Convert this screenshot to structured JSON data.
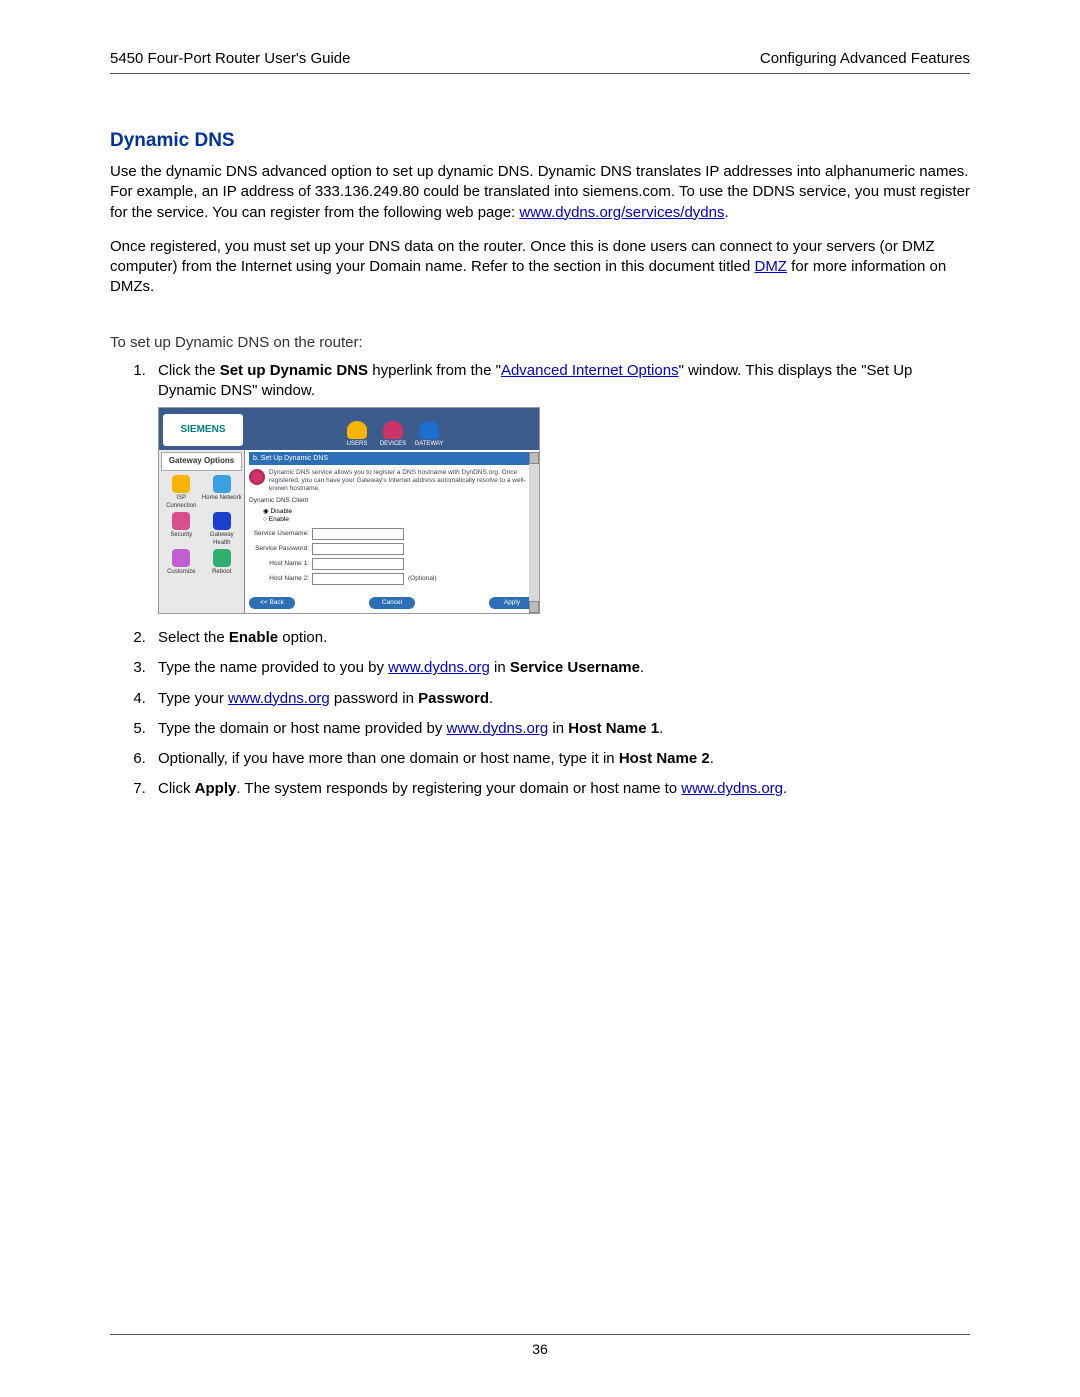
{
  "header": {
    "left": "5450 Four-Port Router User's Guide",
    "right": "Configuring Advanced Features"
  },
  "title": "Dynamic DNS",
  "para1": {
    "t1": "Use the dynamic DNS advanced option to set up dynamic DNS. Dynamic DNS translates IP addresses into alphanumeric names. For example, an IP address of 333.136.249.80 could be translated into siemens.com. To use the DDNS service, you must register for the service. You can register from the following web page: ",
    "link": "www.dydns.org/services/dydns",
    "t2": "."
  },
  "para2": {
    "t1": "Once registered, you must set up your DNS data on the router. Once this is done users can connect to your servers (or DMZ computer) from the Internet using your Domain name. Refer to the section in this document titled ",
    "link": "DMZ",
    "t2": " for more information on DMZs."
  },
  "lead": "To set up Dynamic DNS on the router:",
  "steps": {
    "s1": {
      "t1": "Click the ",
      "b1": "Set up Dynamic DNS",
      "t2": " hyperlink from the \"",
      "link": "Advanced Internet Options",
      "t3": "\" window. This displays the \"Set Up Dynamic DNS\" window."
    },
    "s2": {
      "t1": "Select the ",
      "b1": "Enable",
      "t2": " option."
    },
    "s3": {
      "t1": "Type the name provided to you by ",
      "link": "www.dydns.org",
      "t2": " in ",
      "b1": "Service Username",
      "t3": "."
    },
    "s4": {
      "t1": "Type your ",
      "link": "www.dydns.org",
      "t2": " password in ",
      "b1": "Password",
      "t3": "."
    },
    "s5": {
      "t1": "Type the domain or host name provided by ",
      "link": "www.dydns.org",
      "t2": " in ",
      "b1": "Host Name 1",
      "t3": "."
    },
    "s6": {
      "t1": "Optionally, if you have more than one domain or host name, type it in ",
      "b1": "Host Name 2",
      "t2": "."
    },
    "s7": {
      "t1": "Click ",
      "b1": "Apply",
      "t2": ". The system responds by registering your domain or host name to ",
      "link": "www.dydns.org",
      "t3": "."
    }
  },
  "screenshot": {
    "logo": "SIEMENS",
    "tabs": {
      "users": "USERS",
      "devices": "DEVICES",
      "gateway": "GATEWAY"
    },
    "sidebar": {
      "title": "Gateway Options",
      "items": [
        "ISP Connection",
        "Home Network",
        "Security",
        "Gateway Health",
        "Customize",
        "Reboot"
      ]
    },
    "bar": "b. Set Up Dynamic DNS",
    "desc": "Dynamic DNS service allows you to register a DNS hostname with DynDNS.org. Once registered, you can have your Gateway's Internet address automatically resolve to a well-known hostname.",
    "group": "Dynamic DNS Client",
    "opt_disable": "Disable",
    "opt_enable": "Enable",
    "f_user": "Service Username:",
    "f_pass": "Service Password:",
    "f_h1": "Host Name 1:",
    "f_h2": "Host Name 2:",
    "optional": "(Optional)",
    "btn_back": "<< Back",
    "btn_cancel": "Cancel",
    "btn_apply": "Apply"
  },
  "footer": {
    "page": "36"
  }
}
